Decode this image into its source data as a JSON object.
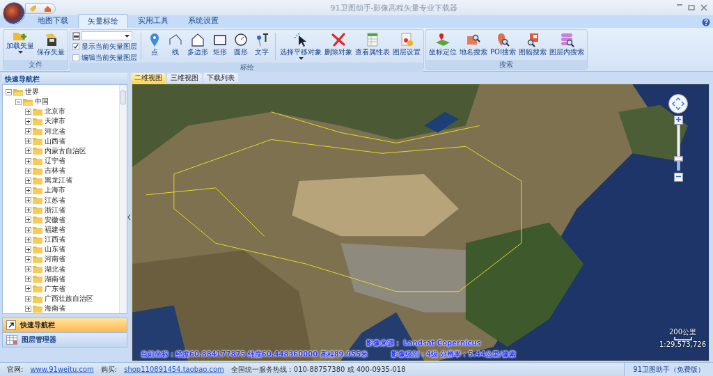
{
  "window": {
    "title": "91卫图助手-影像高程矢量专业下载器"
  },
  "ribbon_tabs": [
    {
      "label": "地图下载",
      "selected": false
    },
    {
      "label": "矢量标绘",
      "selected": true
    },
    {
      "label": "实用工具",
      "selected": false
    },
    {
      "label": "系统设置",
      "selected": false
    }
  ],
  "ribbon_groups": [
    {
      "label": "文件",
      "items": [
        {
          "kind": "button",
          "label": "加载矢量",
          "dropdown": true
        },
        {
          "kind": "button",
          "label": "保存矢量",
          "dropdown": false
        }
      ]
    },
    {
      "label": "标绘",
      "items": [
        {
          "kind": "layer_panel",
          "options": [
            {
              "label": "显示当前矢量图层",
              "checked": true
            },
            {
              "label": "编辑当前矢量图层",
              "checked": false
            }
          ]
        },
        {
          "kind": "separator"
        },
        {
          "kind": "button",
          "label": "点",
          "dropdown": false
        },
        {
          "kind": "button",
          "label": "线",
          "dropdown": false
        },
        {
          "kind": "button",
          "label": "多边形",
          "dropdown": false
        },
        {
          "kind": "button",
          "label": "矩形",
          "dropdown": false
        },
        {
          "kind": "button",
          "label": "圆形",
          "dropdown": false
        },
        {
          "kind": "button",
          "label": "文字",
          "dropdown": false
        },
        {
          "kind": "separator"
        },
        {
          "kind": "button",
          "label": "选择平移对象",
          "dropdown": true
        },
        {
          "kind": "button",
          "label": "删除对象",
          "dropdown": false
        },
        {
          "kind": "button",
          "label": "查看属性表",
          "dropdown": false
        },
        {
          "kind": "button",
          "label": "图层设置",
          "dropdown": false
        }
      ]
    },
    {
      "label": "搜索",
      "items": [
        {
          "kind": "button",
          "label": "坐标定位",
          "dropdown": false
        },
        {
          "kind": "button",
          "label": "地名搜索",
          "dropdown": false
        },
        {
          "kind": "button",
          "label": "POI搜索",
          "dropdown": false
        },
        {
          "kind": "button",
          "label": "图幅搜索",
          "dropdown": false
        },
        {
          "kind": "button",
          "label": "图层内搜索",
          "dropdown": false
        }
      ]
    }
  ],
  "nav_panel": {
    "title": "快速导航栏",
    "tree": [
      {
        "label": "世界",
        "expanded": true,
        "children": [
          {
            "label": "中国",
            "expanded": true,
            "children": [
              {
                "label": "北京市",
                "expanded": false
              },
              {
                "label": "天津市",
                "expanded": false
              },
              {
                "label": "河北省",
                "expanded": false
              },
              {
                "label": "山西省",
                "expanded": false
              },
              {
                "label": "内蒙古自治区",
                "expanded": false
              },
              {
                "label": "辽宁省",
                "expanded": false
              },
              {
                "label": "吉林省",
                "expanded": false
              },
              {
                "label": "黑龙江省",
                "expanded": false
              },
              {
                "label": "上海市",
                "expanded": false
              },
              {
                "label": "江苏省",
                "expanded": false
              },
              {
                "label": "浙江省",
                "expanded": false
              },
              {
                "label": "安徽省",
                "expanded": false
              },
              {
                "label": "福建省",
                "expanded": false
              },
              {
                "label": "江西省",
                "expanded": false
              },
              {
                "label": "山东省",
                "expanded": false
              },
              {
                "label": "河南省",
                "expanded": false
              },
              {
                "label": "湖北省",
                "expanded": false
              },
              {
                "label": "湖南省",
                "expanded": false
              },
              {
                "label": "广东省",
                "expanded": false
              },
              {
                "label": "广西壮族自治区",
                "expanded": false
              },
              {
                "label": "海南省",
                "expanded": false
              }
            ]
          }
        ]
      }
    ]
  },
  "nav_buttons": [
    {
      "label": "快速导航栏",
      "selected": true
    },
    {
      "label": "图层管理器",
      "selected": false
    }
  ],
  "view_tabs": [
    {
      "label": "二维视图",
      "selected": true
    },
    {
      "label": "三维视图",
      "selected": false
    },
    {
      "label": "下载列表",
      "selected": false
    }
  ],
  "map": {
    "kind": "picture",
    "zoom": {
      "level": 0.25
    },
    "scale": {
      "distance": "200公里",
      "ratio": "1:29,573,726"
    },
    "coordinates": "当前坐标：经度60.884177875 纬度60.448360000 高程89.955米",
    "source": "影像来源：  Landsat Copernicus",
    "level_info": "影像级别：4级 分辨率：5.44公里/像素"
  },
  "status_bar": {
    "site_label": "官网:",
    "site_link": "www.91weitu.com",
    "shop_label": "购买:",
    "shop_link": "shop110891454.taobao.com",
    "hotline": "全国统一服务热线：010-88757380 或 400-0935-018",
    "edition": "91卫图助手（免费版）"
  }
}
